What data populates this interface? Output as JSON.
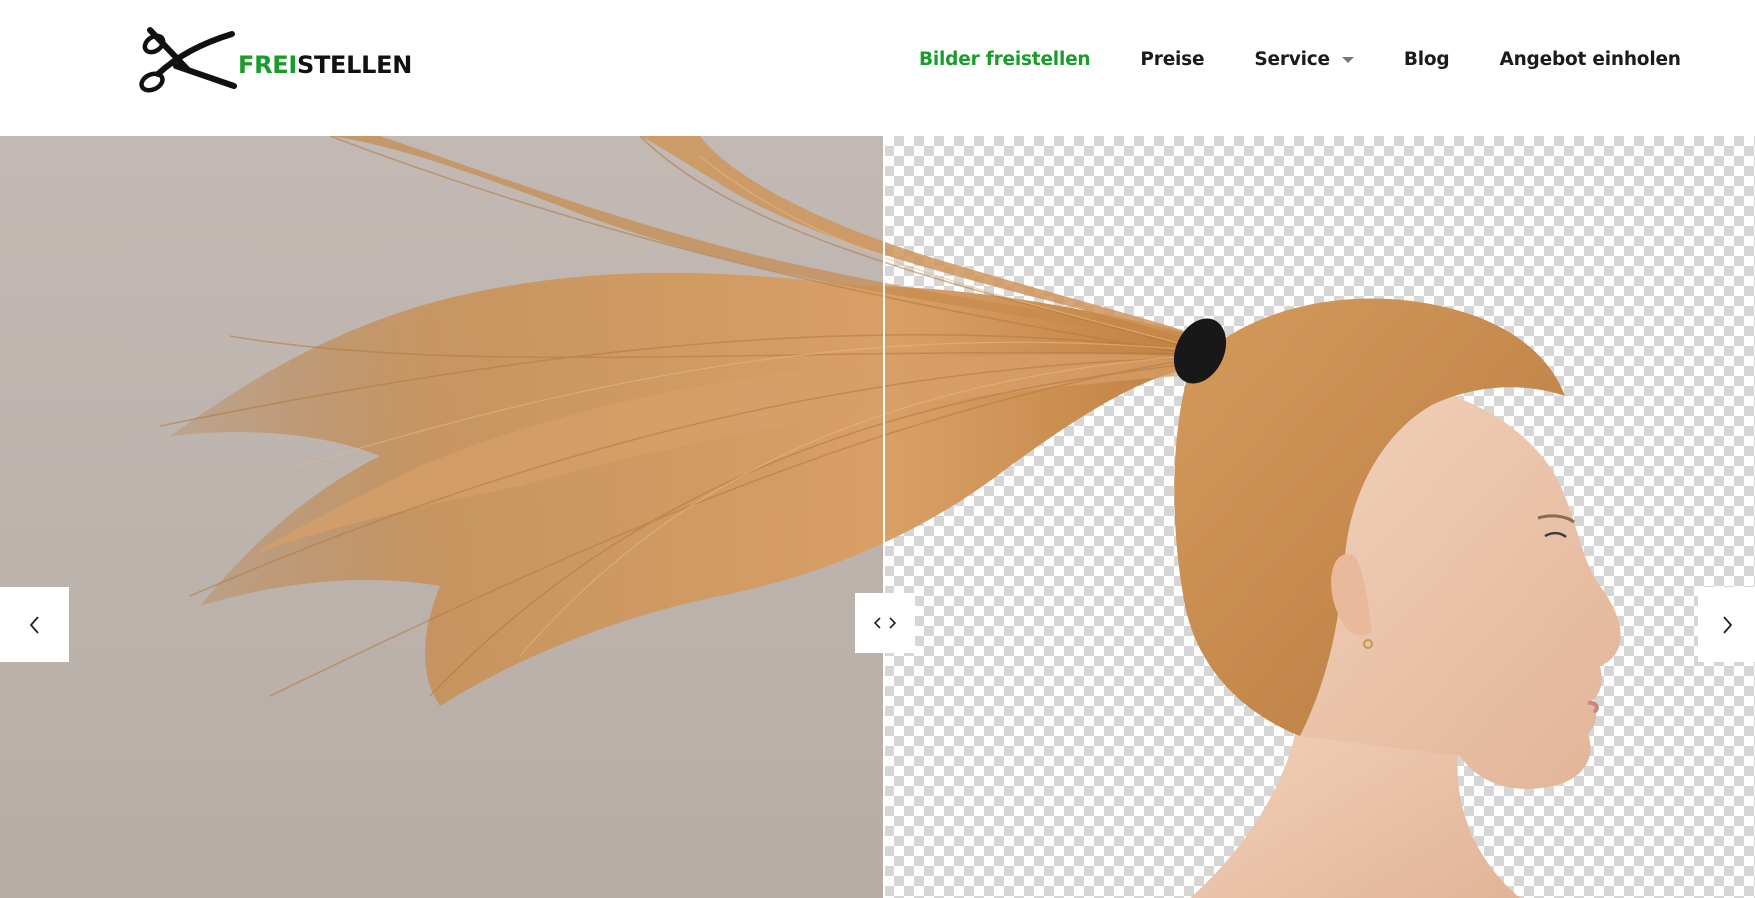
{
  "logo": {
    "text_accent": "FREI",
    "text_main": "STELLEN",
    "icon": "scissors-icon"
  },
  "nav": {
    "items": [
      {
        "label": "Bilder freistellen",
        "active": true
      },
      {
        "label": "Preise",
        "active": false
      },
      {
        "label": "Service",
        "active": false,
        "has_dropdown": true
      },
      {
        "label": "Blog",
        "active": false
      },
      {
        "label": "Angebot einholen",
        "active": false
      }
    ]
  },
  "slider": {
    "before_label": "Original photo with grey background",
    "after_label": "Cut-out photo on transparent background",
    "divider_position": 0.504,
    "prev_icon": "chevron-left-icon",
    "next_icon": "chevron-right-icon",
    "handle_icon": "left-right-arrows-icon"
  },
  "colors": {
    "accent": "#1a9c2c",
    "nav_text": "#1b1b1b",
    "background_before": "#bdb3ad",
    "checker_dark": "#d6d6d6",
    "checker_light": "#ffffff"
  }
}
